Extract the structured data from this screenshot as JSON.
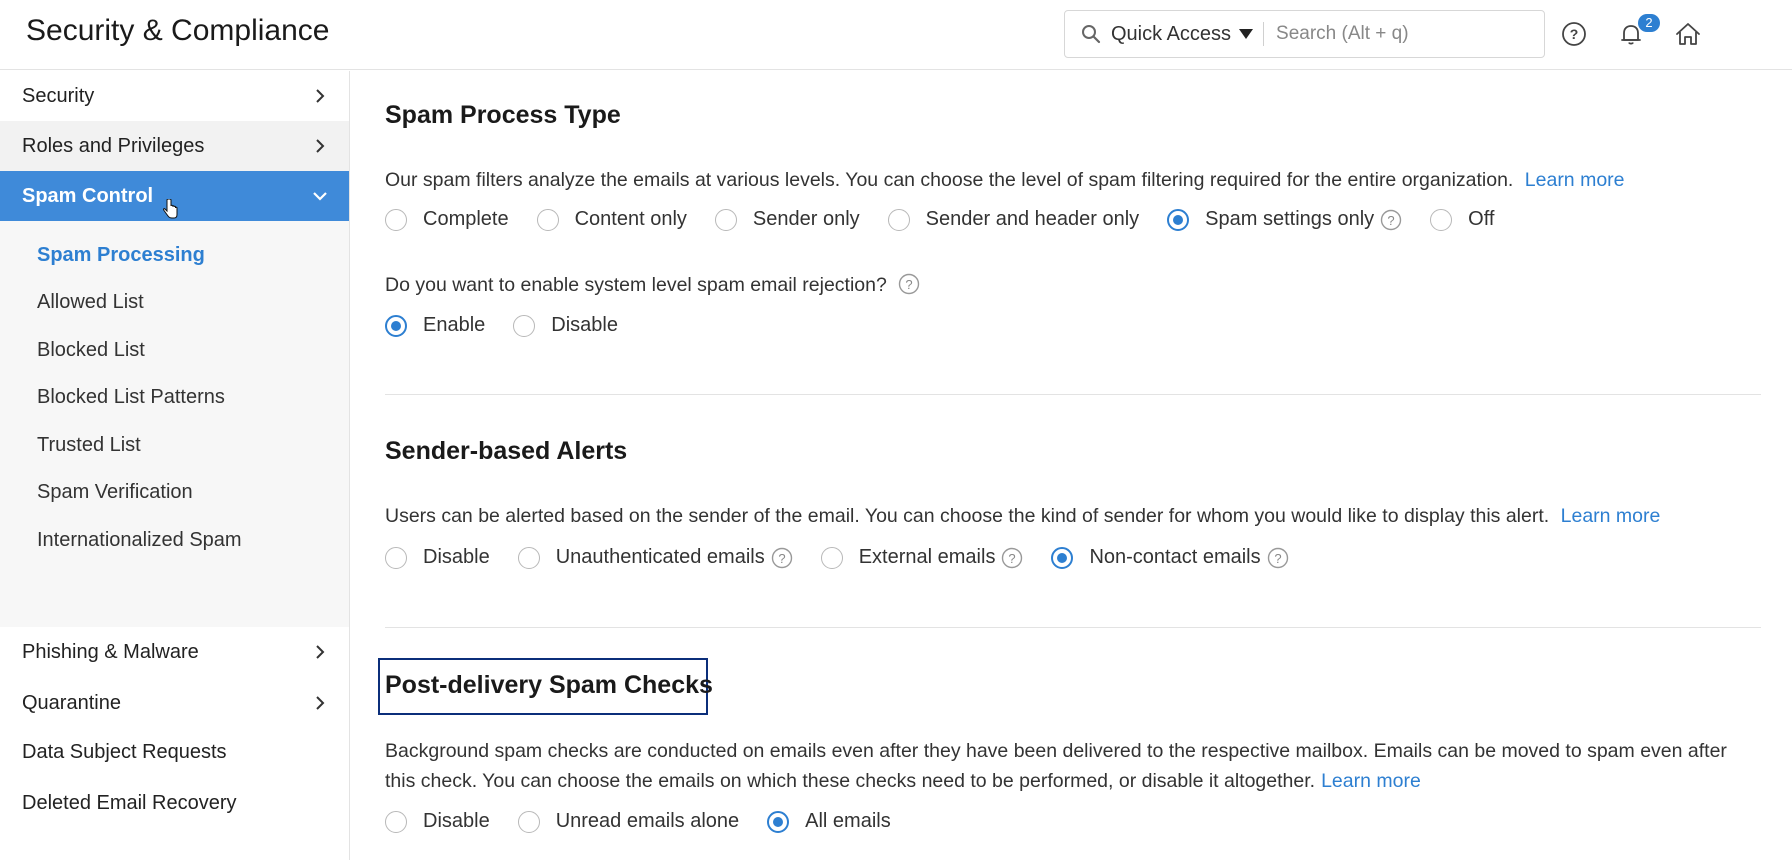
{
  "app": {
    "title": "Security & Compliance"
  },
  "header": {
    "quick_access_label": "Quick Access",
    "search_placeholder": "Search (Alt + q)",
    "notification_count": "2",
    "icons": [
      "search-icon",
      "caret-down-icon",
      "help-icon",
      "bell-icon",
      "home-icon"
    ]
  },
  "sidebar": {
    "items": [
      {
        "label": "Security",
        "has_chevron": true
      },
      {
        "label": "Roles and Privileges",
        "has_chevron": true
      },
      {
        "label": "Spam Control",
        "has_chevron": true,
        "expanded": true,
        "active": true
      },
      {
        "label": "Phishing & Malware",
        "has_chevron": true
      },
      {
        "label": "Quarantine",
        "has_chevron": true
      },
      {
        "label": "Data Subject Requests"
      },
      {
        "label": "Deleted Email Recovery"
      }
    ],
    "subitems": [
      {
        "label": "Spam Processing",
        "active": true
      },
      {
        "label": "Allowed List"
      },
      {
        "label": "Blocked List"
      },
      {
        "label": "Blocked List Patterns"
      },
      {
        "label": "Trusted List"
      },
      {
        "label": "Spam Verification"
      },
      {
        "label": "Internationalized Spam"
      }
    ]
  },
  "sections": {
    "spam_process": {
      "title": "Spam Process Type",
      "description": "Our spam filters analyze the emails at various levels. You can choose the level of spam filtering required for the entire organization.",
      "learn_more": "Learn more",
      "options": [
        "Complete",
        "Content only",
        "Sender only",
        "Sender and header only",
        "Spam settings only",
        "Off"
      ],
      "selected": "Spam settings only",
      "rejection_question": "Do you want to enable system level spam email rejection?",
      "rejection_options": [
        "Enable",
        "Disable"
      ],
      "rejection_selected": "Enable"
    },
    "sender_alerts": {
      "title": "Sender-based Alerts",
      "description": "Users can be alerted based on the sender of the email. You can choose the kind of sender for whom you would like to display this alert.",
      "learn_more": "Learn more",
      "options": [
        "Disable",
        "Unauthenticated emails",
        "External emails",
        "Non-contact emails"
      ],
      "selected": "Non-contact emails"
    },
    "post_delivery": {
      "title": "Post-delivery Spam Checks",
      "description_line1": "Background spam checks are conducted on emails even after they have been delivered to the respective mailbox. Emails can be moved to spam even after",
      "description_line2": "this check. You can choose the emails on which these checks need to be performed, or disable it altogether.",
      "learn_more": "Learn more",
      "options": [
        "Disable",
        "Unread emails alone",
        "All emails"
      ],
      "selected": "All emails"
    }
  },
  "colors": {
    "accent": "#2d7fd1",
    "active_nav": "#3f8ad9",
    "focus_border": "#0b2e7a"
  }
}
